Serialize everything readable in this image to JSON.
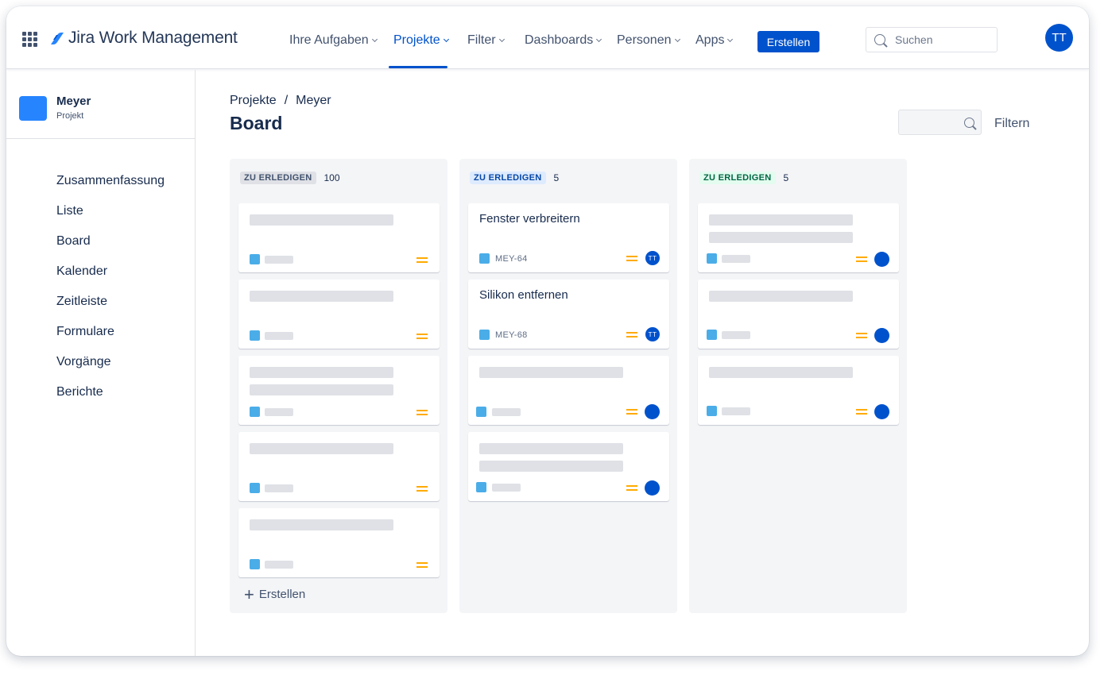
{
  "topnav": {
    "app_name": "Jira Work Management",
    "items": [
      {
        "label": "Ihre Aufgaben"
      },
      {
        "label": "Projekte",
        "active": true
      },
      {
        "label": "Filter"
      },
      {
        "label": "Dashboards"
      },
      {
        "label": "Personen"
      },
      {
        "label": "Apps"
      }
    ],
    "create_label": "Erstellen",
    "search_placeholder": "Suchen",
    "user_initials": "TT"
  },
  "sidebar": {
    "project_name": "Meyer",
    "project_type": "Projekt",
    "items": [
      {
        "label": "Zusammenfassung"
      },
      {
        "label": "Liste"
      },
      {
        "label": "Board"
      },
      {
        "label": "Kalender"
      },
      {
        "label": "Zeitleiste"
      },
      {
        "label": "Formulare"
      },
      {
        "label": "Vorgänge"
      },
      {
        "label": "Berichte"
      }
    ]
  },
  "breadcrumb": {
    "parent": "Projekte",
    "separator": "/",
    "current": "Meyer"
  },
  "page_title": "Board",
  "filter_label": "Filtern",
  "columns": [
    {
      "status": "ZU ERLEDIGEN",
      "count": "100",
      "create_label": "Erstellen"
    },
    {
      "status": "ZU ERLEDIGEN",
      "count": "5",
      "cards": [
        {
          "title": "Fenster verbreitern",
          "key": "MEY-64",
          "assignee": "TT"
        },
        {
          "title": "Silikon entfernen",
          "key": "MEY-68",
          "assignee": "TT"
        }
      ]
    },
    {
      "status": "ZU ERLEDIGEN",
      "count": "5"
    }
  ],
  "colors": {
    "primary": "#0052cc",
    "priority_medium": "#ffab00",
    "issue_type": "#4bade8",
    "project_icon": "#2684ff"
  }
}
